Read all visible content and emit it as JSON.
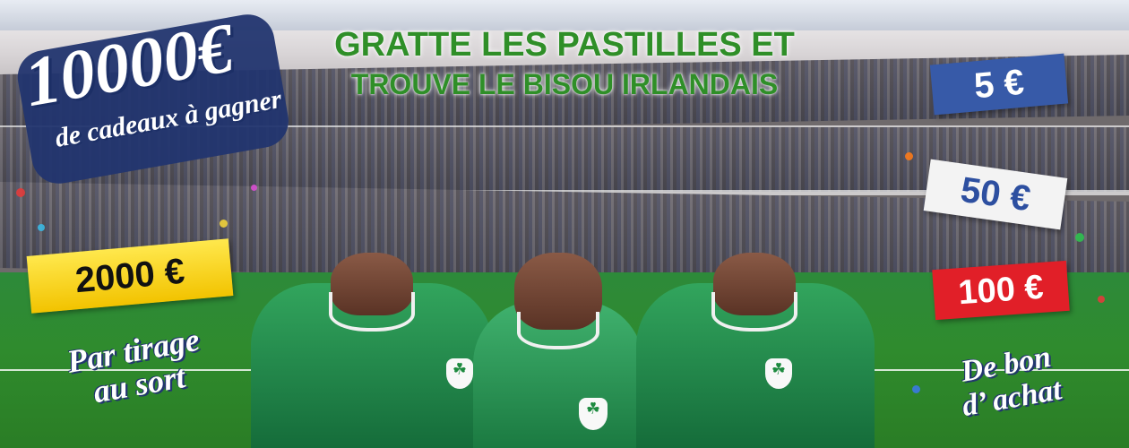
{
  "headline": {
    "line1": "GRATTE LES PASTILLES ET",
    "line2": "TROUVE LE BISOU IRLANDAIS"
  },
  "main_prize": {
    "amount": "10000€",
    "subtitle": "de cadeaux à gagner"
  },
  "draw_prize": {
    "amount": "2000 €",
    "caption_line1": "Par tirage",
    "caption_line2": "au sort"
  },
  "vouchers": {
    "v5": "5 €",
    "v50": "50 €",
    "v100": "100 €",
    "caption_line1": "De bon",
    "caption_line2": "d’ achat"
  },
  "colors": {
    "green": "#2f8f28",
    "blue": "#375aa8",
    "red": "#e11f28",
    "yellow": "#f2c300"
  }
}
